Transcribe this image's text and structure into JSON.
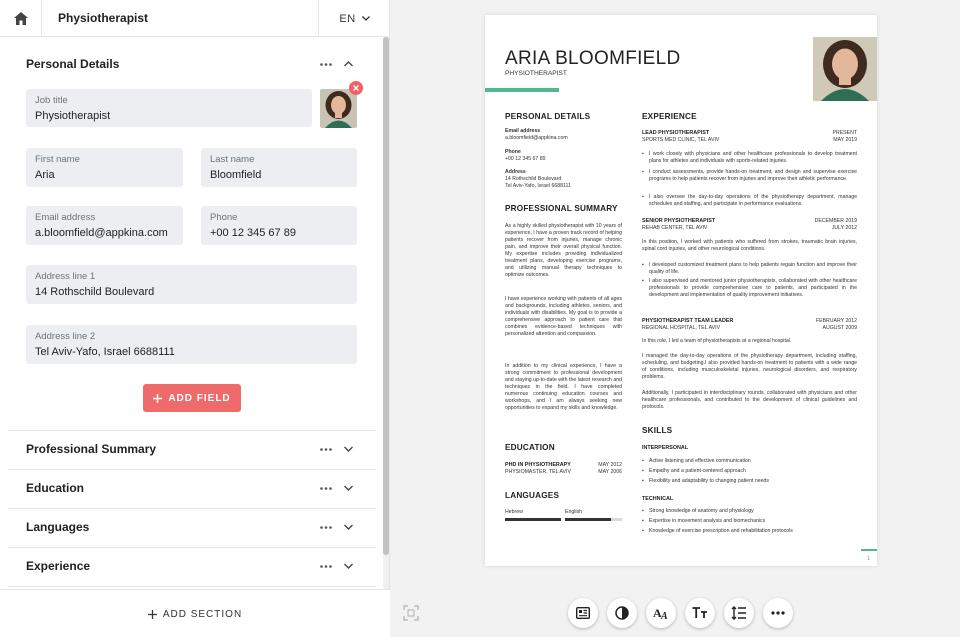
{
  "topbar": {
    "title": "Physiotherapist",
    "lang": "EN"
  },
  "personal": {
    "title": "Personal Details",
    "job_label": "Job title",
    "job_value": "Physiotherapist",
    "first_label": "First name",
    "first_value": "Aria",
    "last_label": "Last name",
    "last_value": "Bloomfield",
    "email_label": "Email address",
    "email_value": "a.bloomfield@appkina.com",
    "phone_label": "Phone",
    "phone_value": "+00 12 345 67 89",
    "addr1_label": "Address line 1",
    "addr1_value": "14 Rothschild Boulevard",
    "addr2_label": "Address line 2",
    "addr2_value": "Tel Aviv-Yafo, Israel 6688111",
    "add_field": "ADD FIELD"
  },
  "sections": [
    "Professional Summary",
    "Education",
    "Languages",
    "Experience"
  ],
  "add_section": "ADD SECTION",
  "resume": {
    "name": "ARIA BLOOMFIELD",
    "role": "PHYSIOTHERAPIST",
    "h_personal": "PERSONAL DETAILS",
    "email_k": "Email address",
    "email_v": "a.bloomfield@appkina.com",
    "phone_k": "Phone",
    "phone_v": "+00 12 345 67 89",
    "addr_k": "Address",
    "addr_v1": "14 Rothschild Boulevard",
    "addr_v2": "Tel Aviv-Yafo, Israel 6688111",
    "h_summary": "PROFESSIONAL SUMMARY",
    "summary_p1": "As a highly skilled physiotherapist with 10 years of experience, I have a proven track record of helping patients recover from injuries, manage chronic pain, and improve their overall physical function. My expertise includes providing individualized treatment plans, developing exercise programs, and utilizing manual therapy techniques to optimize outcomes.",
    "summary_p2": "I have experience working with patients of all ages and backgrounds, including athletes, seniors, and individuals with disabilities. My goal is to provide a comprehensive approach to patient care that combines evidence-based techniques with personalized attention and compassion.",
    "summary_p3": "In addition to my clinical experience, I have a strong commitment to professional development and staying up-to-date with the latest research and techniques in the field. I have completed numerous continuing education courses and workshops, and I am always seeking new opportunities to expand my skills and knowledge.",
    "h_education": "EDUCATION",
    "edu_degree": "PHD IN PHYSIOTHERAPY",
    "edu_school": "PHYSIOMASTER, TEL AVIV",
    "edu_d1": "MAY 2012",
    "edu_d2": "MAY 2006",
    "h_languages": "LANGUAGES",
    "lang1": "Hebrew",
    "lang2": "English",
    "h_experience": "EXPERIENCE",
    "job1_title": "LEAD PHYSIOTHERAPIST",
    "job1_org": "SPORTS MED CLINIC, TEL AVIV",
    "job1_d1": "PRESENT",
    "job1_d2": "MAY 2019",
    "job1_b1": "I work closely with physicians and other healthcare professionals to develop treatment plans for athletes and individuals with sports-related injuries.",
    "job1_b2": "I conduct assessments, provide hands-on treatment, and design and supervise exercise programs to help patients recover from injuries and improve their athletic performance.",
    "job1_b3": "I also oversee the day-to-day operations of the physiotherapy department, manage schedules and staffing, and participate in performance evaluations.",
    "job2_title": "SENIOR PHYSIOTHERAPIST",
    "job2_org": "REHAB CENTER, TEL AVIV",
    "job2_d1": "DECEMBER 2019",
    "job2_d2": "JULY 2012",
    "job2_p": "In this position, I worked with patients who suffered from strokes, traumatic brain injuries, spinal cord injuries, and other neurological conditions.",
    "job2_b1": "I developed customized treatment plans to help patients regain function and improve their quality of life.",
    "job2_b2": "I also supervised and mentored junior physiotherapists, collaborated with other healthcare professionals to provide comprehensive care to patients, and participated in the development and implementation of quality improvement initiatives.",
    "job3_title": "PHYSIOTHERAPIST TEAM LEADER",
    "job3_org": "REGIONAL HOSPITAL, TEL AVIV",
    "job3_d1": "FEBRUARY 2012",
    "job3_d2": "AUGUST 2009",
    "job3_p1": "In this role, I led a team of physiotherapists at a regional hospital.",
    "job3_p2": "I managed the day-to-day operations of the physiotherapy department, including staffing, scheduling, and budgeting.I also provided hands-on treatment to patients with a wide range of conditions, including musculoskeletal injuries, neurological disorders, and respiratory problems.",
    "job3_p3": "Additionally, I participated in interdisciplinary rounds, collaborated with physicians and other healthcare professionals, and contributed to the development of clinical guidelines and protocols.",
    "h_skills": "SKILLS",
    "skills_inter": "INTERPERSONAL",
    "skill_i1": "Active listening and effective communication",
    "skill_i2": "Empathy and a patient-centered approach",
    "skill_i3": "Flexibility and adaptability to changing patient needs",
    "skills_tech": "TECHNICAL",
    "skill_t1": "Strong knowledge of anatomy and physiology",
    "skill_t2": "Expertise in movement analysis and biomechanics",
    "skill_t3": "Knowledge of exercise prescription and rehabilitation protocols",
    "page": "1"
  },
  "lang_levels": {
    "hebrew": 1.0,
    "english": 0.8
  },
  "colors": {
    "accent": "#4fb88c",
    "button": "#ee6a6b",
    "delete": "#f06266"
  },
  "tools": [
    "document-icon",
    "contrast-icon",
    "font-icon",
    "text-size-icon",
    "line-spacing-icon",
    "more-icon"
  ]
}
